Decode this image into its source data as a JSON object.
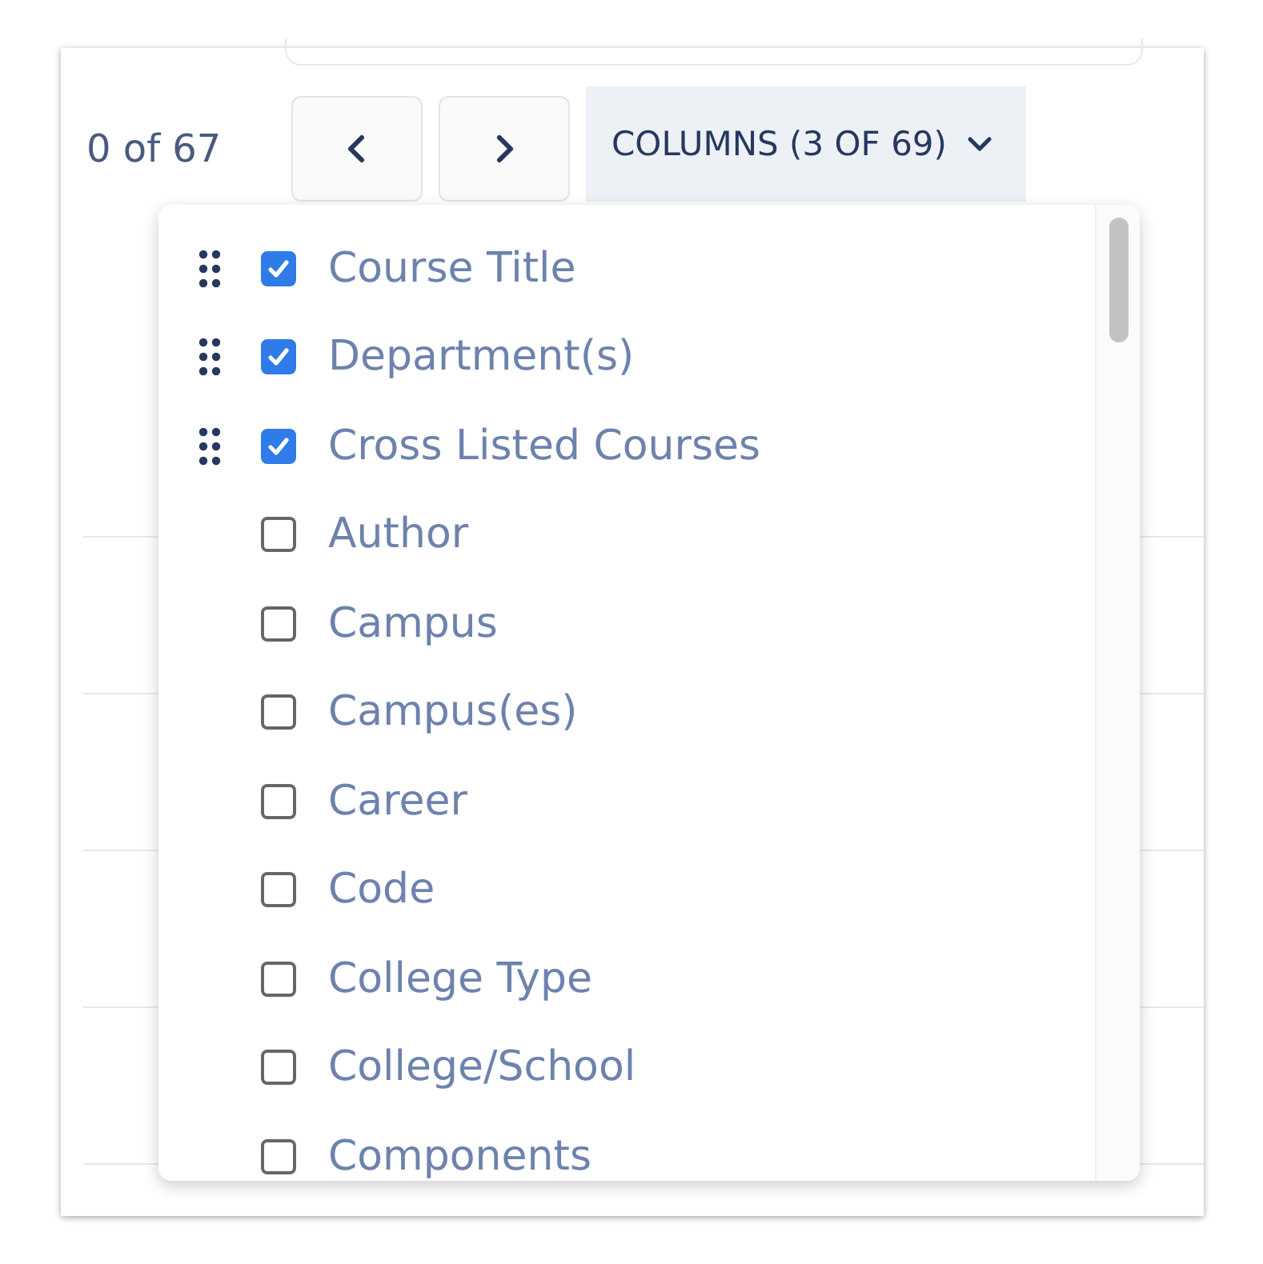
{
  "pagination": {
    "count": "0 of 67"
  },
  "columns_button": {
    "label": "COLUMNS (3 OF 69)",
    "expanded": true
  },
  "columns_menu": {
    "items": [
      {
        "label": "Course Title",
        "checked": true
      },
      {
        "label": "Department(s)",
        "checked": true
      },
      {
        "label": "Cross Listed Courses",
        "checked": true
      },
      {
        "label": "Author",
        "checked": false
      },
      {
        "label": "Campus",
        "checked": false
      },
      {
        "label": "Campus(es)",
        "checked": false
      },
      {
        "label": "Career",
        "checked": false
      },
      {
        "label": "Code",
        "checked": false
      },
      {
        "label": "College Type",
        "checked": false
      },
      {
        "label": "College/School",
        "checked": false
      },
      {
        "label": "Components",
        "checked": false
      }
    ]
  }
}
